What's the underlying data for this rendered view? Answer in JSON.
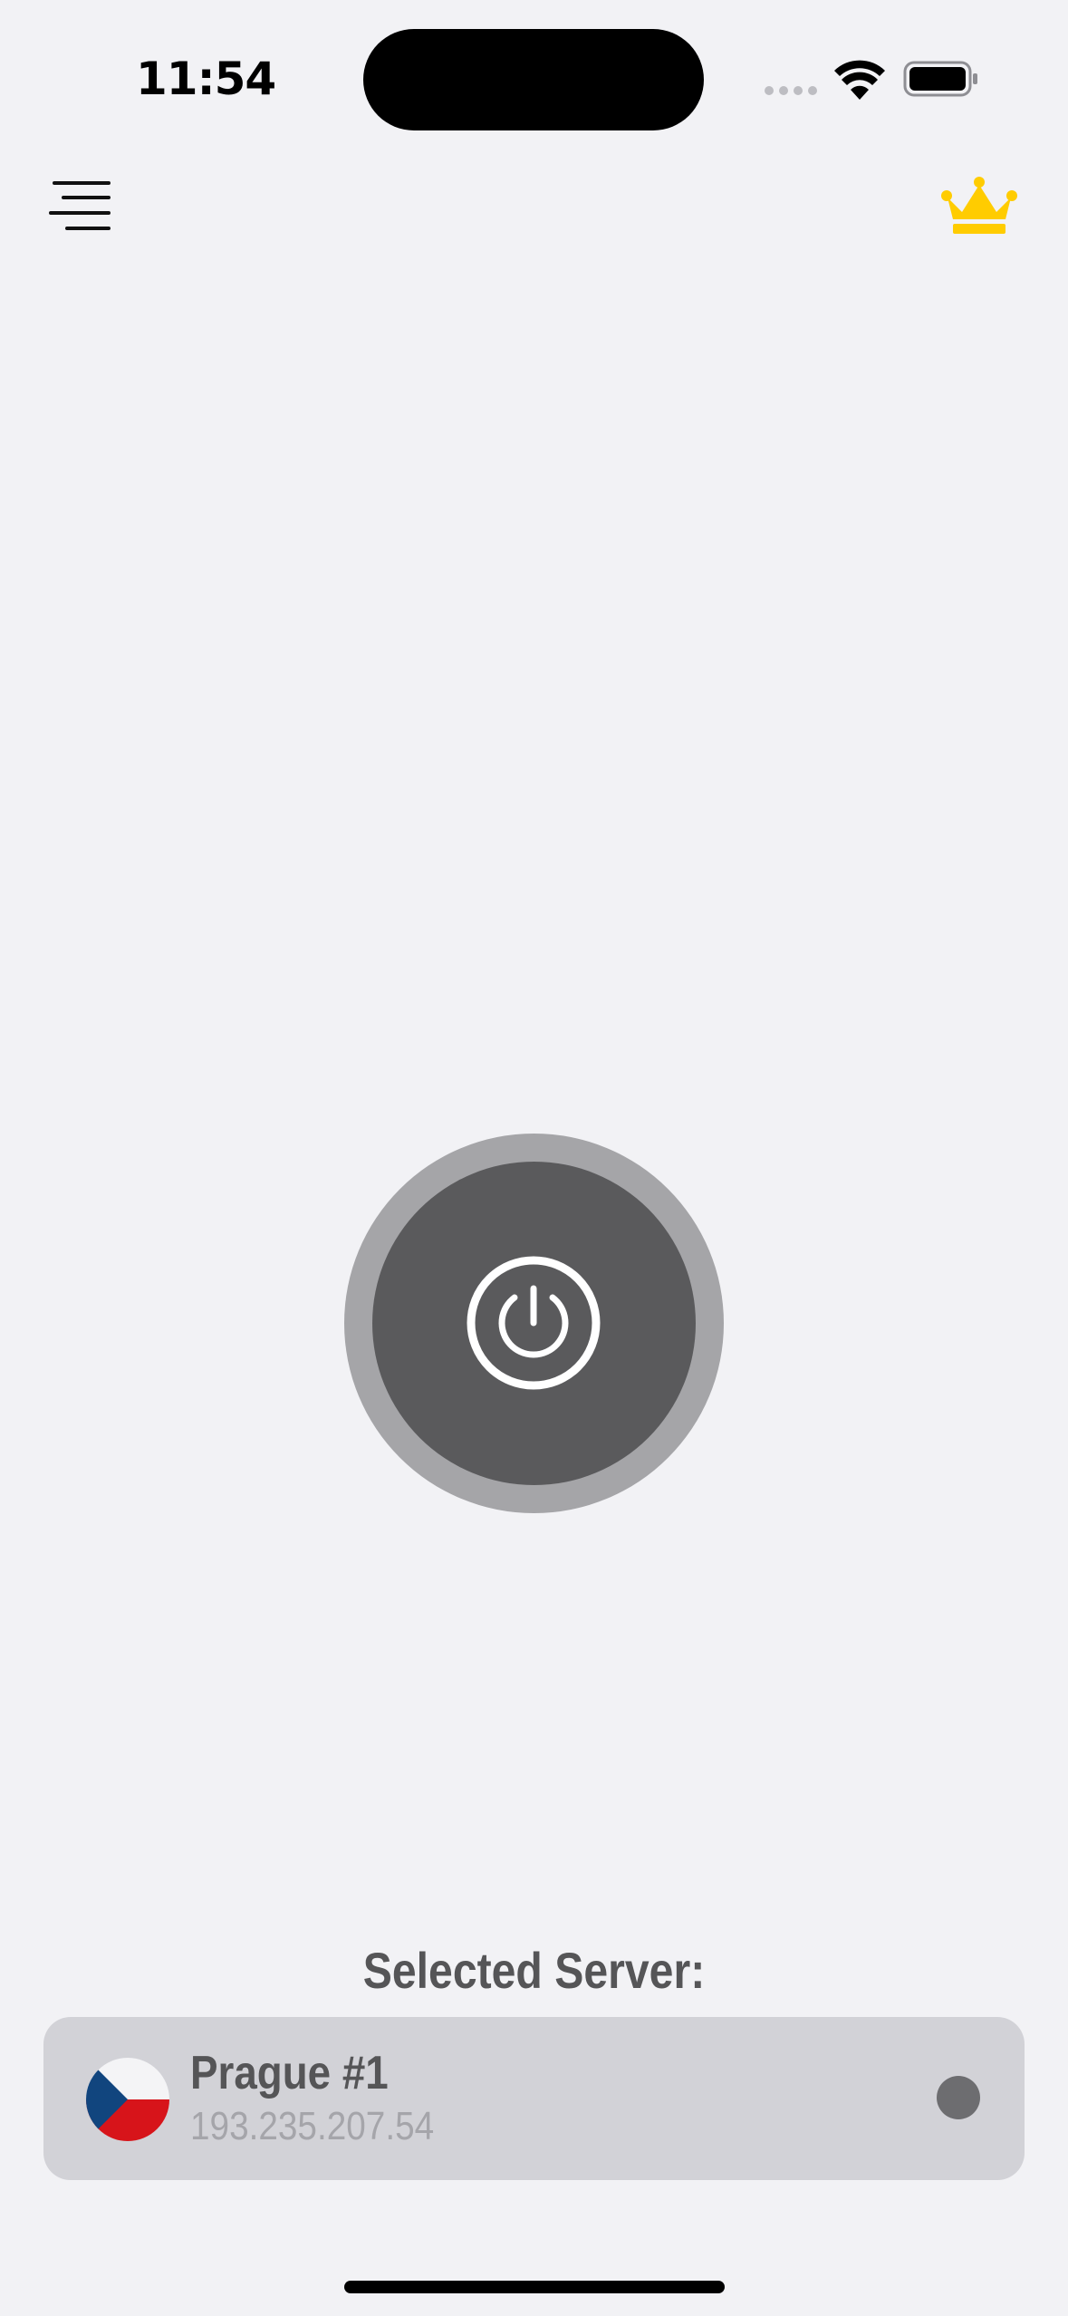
{
  "status_bar": {
    "time": "11:54",
    "cellular_icon": "cellular-signal-icon",
    "wifi_icon": "wifi-icon",
    "battery_icon": "battery-icon"
  },
  "nav": {
    "menu_icon": "menu-icon",
    "premium_icon": "crown-icon",
    "premium_color": "#ffcc00"
  },
  "connect": {
    "power_icon": "power-icon",
    "state_color": "#5a5a5c"
  },
  "selected_server": {
    "label": "Selected Server:",
    "name": "Prague #1",
    "ip": "193.235.207.54",
    "flag_icon": "czech-flag-icon",
    "status_color": "#6d6d70"
  }
}
